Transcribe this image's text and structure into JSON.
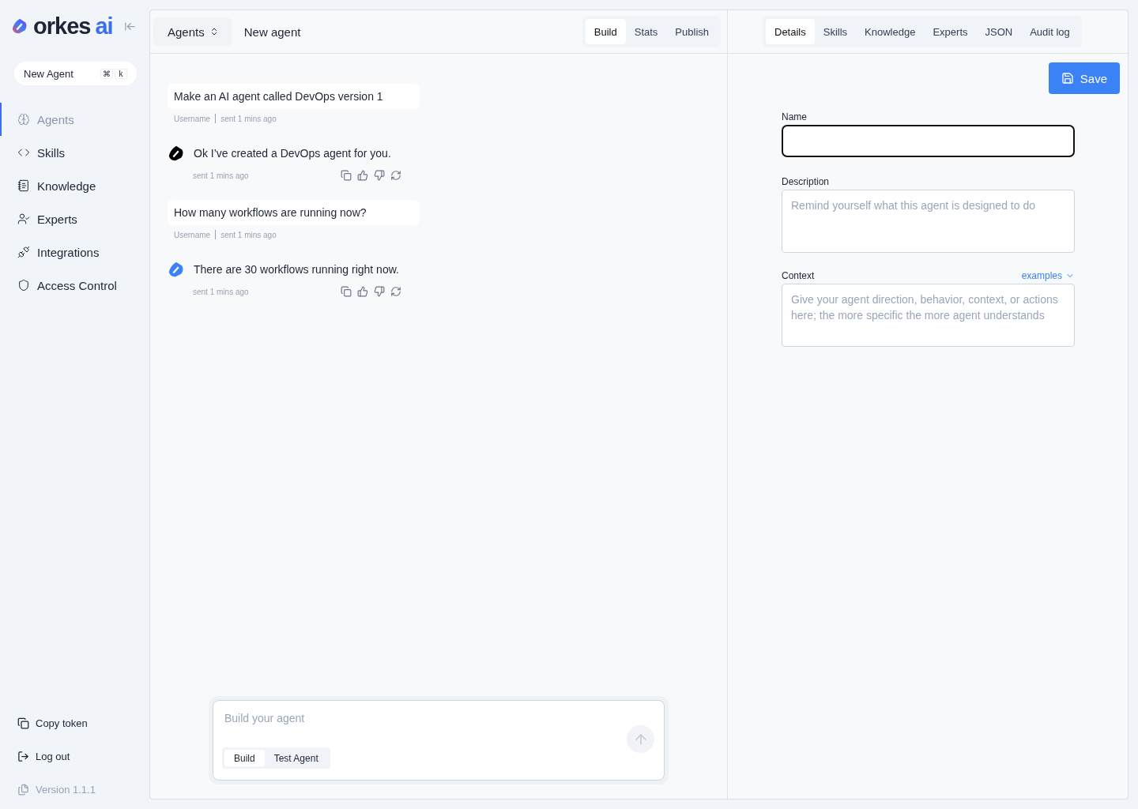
{
  "brand": {
    "name": "orkes",
    "suffix": "ai"
  },
  "new_agent": {
    "label": "New Agent",
    "keys": [
      "⌘",
      "k"
    ]
  },
  "nav": [
    {
      "label": "Agents",
      "selected": true
    },
    {
      "label": "Skills",
      "selected": false
    },
    {
      "label": "Knowledge",
      "selected": false
    },
    {
      "label": "Experts",
      "selected": false
    },
    {
      "label": "Integrations",
      "selected": false
    },
    {
      "label": "Access Control",
      "selected": false
    }
  ],
  "sidebar_footer": {
    "copy_token": "Copy token",
    "log_out": "Log out",
    "version": "Version 1.1.1"
  },
  "header": {
    "breadcrumb": "Agents",
    "title": "New agent"
  },
  "build_tabs": [
    {
      "label": "Build",
      "selected": true
    },
    {
      "label": "Stats",
      "selected": false
    },
    {
      "label": "Publish",
      "selected": false
    }
  ],
  "detail_tabs": [
    {
      "label": "Details",
      "selected": true
    },
    {
      "label": "Skills",
      "selected": false
    },
    {
      "label": "Knowledge",
      "selected": false
    },
    {
      "label": "Experts",
      "selected": false
    },
    {
      "label": "JSON",
      "selected": false
    },
    {
      "label": "Audit log",
      "selected": false
    }
  ],
  "messages": [
    {
      "kind": "user",
      "text": "Make an AI agent called DevOps version 1",
      "author": "Username",
      "time": "sent 1 mins ago"
    },
    {
      "kind": "agent",
      "color": "#000000",
      "text": "Ok I’ve created a DevOps agent for you.",
      "time": "sent 1 mins ago"
    },
    {
      "kind": "user",
      "text": "How many workflows are running now?",
      "author": "Username",
      "time": "sent 1 mins ago"
    },
    {
      "kind": "agent",
      "color": "#3b82f6",
      "text": "There are 30 workflows running right now.",
      "time": "sent 1 mins ago"
    }
  ],
  "composer": {
    "placeholder": "Build your agent",
    "modes": [
      {
        "label": "Build",
        "selected": true
      },
      {
        "label": "Test Agent",
        "selected": false
      }
    ]
  },
  "save": "Save",
  "form": {
    "name": {
      "label": "Name"
    },
    "description": {
      "label": "Description",
      "placeholder": "Remind yourself what this agent is designed to do"
    },
    "context": {
      "label": "Context",
      "link": "examples",
      "placeholder": "Give your agent direction, behavior, context, or actions here; the more specific the more agent understands"
    }
  }
}
